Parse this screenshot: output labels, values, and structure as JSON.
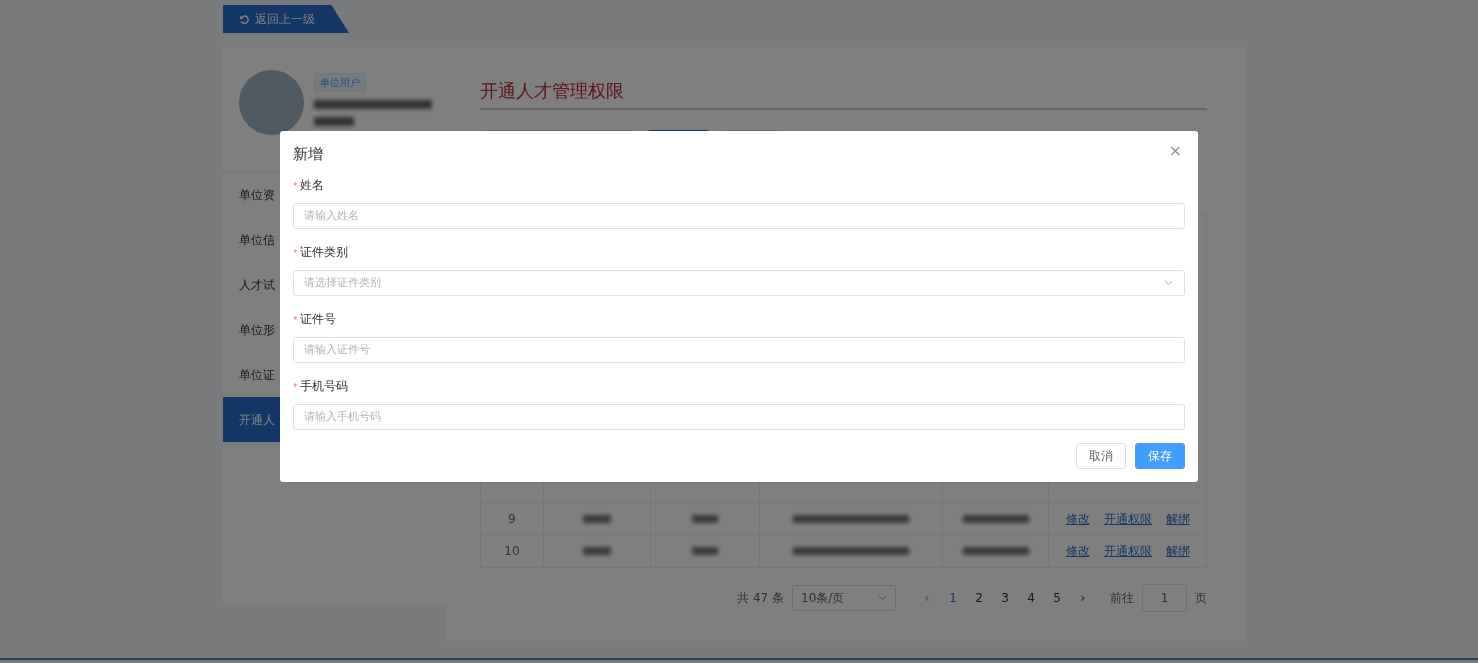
{
  "back_button": {
    "label": "返回上一级"
  },
  "profile": {
    "tag": "单位用户"
  },
  "sidebar": {
    "items": [
      {
        "label": "单位资",
        "selected": false
      },
      {
        "label": "单位信",
        "selected": false
      },
      {
        "label": "人才试",
        "selected": false
      },
      {
        "label": "单位形",
        "selected": false
      },
      {
        "label": "单位证",
        "selected": false
      },
      {
        "label": "开通人",
        "selected": true
      }
    ]
  },
  "main": {
    "title": "开通人才管理权限"
  },
  "table": {
    "rows": [
      {
        "index": "9",
        "actions": [
          "修改",
          "开通权限",
          "解绑"
        ]
      },
      {
        "index": "10",
        "actions": [
          "修改",
          "开通权限",
          "解绑"
        ]
      }
    ]
  },
  "pagination": {
    "total": "共 47 条",
    "page_size": "10条/页",
    "prev": "‹",
    "pages": [
      {
        "label": "1",
        "selected": true
      },
      {
        "label": "2",
        "selected": false
      },
      {
        "label": "3",
        "selected": false
      },
      {
        "label": "4",
        "selected": false
      },
      {
        "label": "5",
        "selected": false
      }
    ],
    "next": "›",
    "goto_label": "前往",
    "goto_value": "1",
    "goto_suffix": "页"
  },
  "dialog": {
    "title": "新增",
    "close": "×",
    "fields": [
      {
        "required_mark": "*",
        "label": "姓名",
        "kind": "input",
        "placeholder": "请输入姓名"
      },
      {
        "required_mark": "*",
        "label": "证件类别",
        "kind": "select",
        "placeholder": "请选择证件类别"
      },
      {
        "required_mark": "*",
        "label": "证件号",
        "kind": "input",
        "placeholder": "请输入证件号"
      },
      {
        "required_mark": "*",
        "label": "手机号码",
        "kind": "input",
        "placeholder": "请输入手机号码"
      }
    ],
    "buttons": [
      {
        "label": "取消",
        "kind": "default"
      },
      {
        "label": "保存",
        "kind": "primary"
      }
    ]
  }
}
